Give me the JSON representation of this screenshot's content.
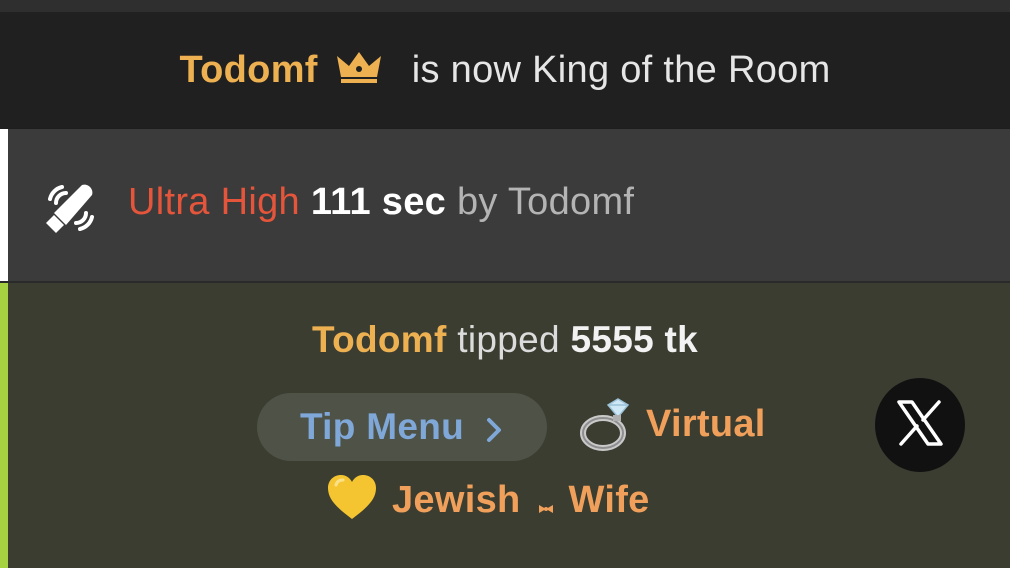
{
  "king_notice": {
    "username": "Todomf",
    "message": "is now King of the Room",
    "icon": "crown-icon",
    "username_color": "#eeb152"
  },
  "level_notice": {
    "icon": "vibrating-toy-icon",
    "level_name": "Ultra High",
    "duration": "111 sec",
    "by_text": "by Todomf",
    "level_color": "#e5553b"
  },
  "tip_notice": {
    "username": "Todomf",
    "verb": "tipped",
    "amount": "5555 tk",
    "stripe_color": "#a6d241",
    "menu_button_label": "Tip Menu",
    "item_line_1": {
      "emoji_icon": "ring-emoji-icon",
      "text": "Virtual"
    },
    "item_line_2": {
      "emoji_icon": "yellow-heart-emoji-icon",
      "word1": "Jewish",
      "separator_icon": "bow-icon",
      "word2": "Wife"
    }
  },
  "x_button": {
    "icon": "x-logo-icon"
  }
}
